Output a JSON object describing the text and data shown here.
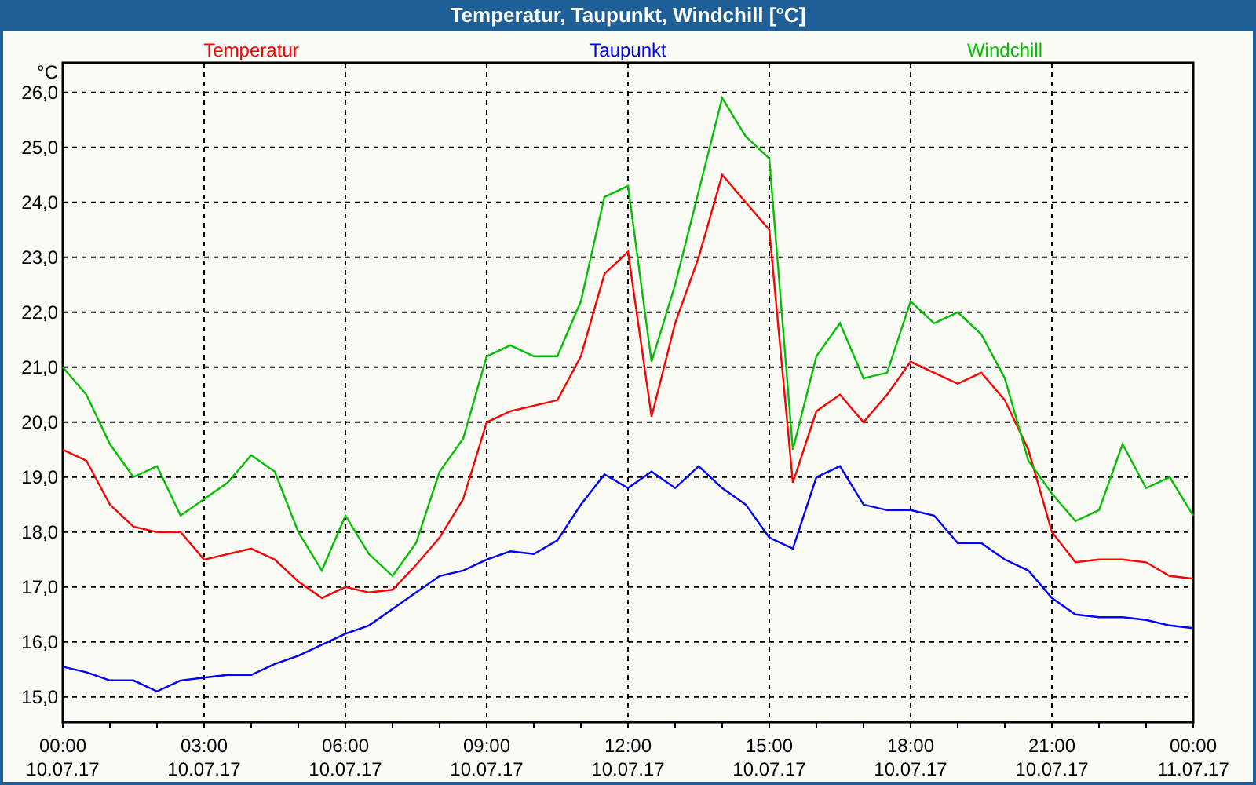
{
  "window": {
    "title": "Temperatur, Taupunkt, Windchill [°C]"
  },
  "chart": {
    "chart_data": {
      "type": "line",
      "ylabel": "°C",
      "categories": [
        "00:00 10.07.17",
        null,
        null,
        null,
        null,
        null,
        "03:00 10.07.17",
        null,
        null,
        null,
        null,
        null,
        "06:00 10.07.17",
        null,
        null,
        null,
        null,
        null,
        "09:00 10.07.17",
        null,
        null,
        null,
        null,
        null,
        "12:00 10.07.17",
        null,
        null,
        null,
        null,
        null,
        "15:00 10.07.17",
        null,
        null,
        null,
        null,
        null,
        "18:00 10.07.17",
        null,
        null,
        null,
        null,
        null,
        "21:00 10.07.17",
        null,
        null,
        null,
        null,
        null,
        "00:00 11.07.17"
      ],
      "series": [
        {
          "name": "Temperatur",
          "color": "#ff0000",
          "values": [
            19.5,
            19.3,
            18.5,
            18.1,
            18.0,
            18.0,
            17.5,
            17.6,
            17.7,
            17.5,
            17.1,
            16.8,
            17.0,
            16.9,
            16.95,
            17.4,
            17.9,
            18.6,
            20.0,
            20.2,
            20.3,
            20.4,
            21.2,
            22.7,
            23.1,
            20.1,
            21.8,
            23.0,
            24.5,
            24.0,
            23.5,
            18.9,
            20.2,
            20.5,
            20.0,
            20.5,
            21.1,
            20.9,
            20.7,
            20.9,
            20.4,
            19.5,
            18.0,
            17.45,
            17.5,
            17.5,
            17.45,
            17.2,
            17.15
          ]
        },
        {
          "name": "Taupunkt",
          "color": "#0000ff",
          "values": [
            15.55,
            15.45,
            15.3,
            15.3,
            15.1,
            15.3,
            15.35,
            15.4,
            15.4,
            15.6,
            15.75,
            15.95,
            16.15,
            16.3,
            16.6,
            16.9,
            17.2,
            17.3,
            17.5,
            17.65,
            17.6,
            17.85,
            18.5,
            19.05,
            18.8,
            19.1,
            18.8,
            19.2,
            18.8,
            18.5,
            17.9,
            17.7,
            19.0,
            19.2,
            18.5,
            18.4,
            18.4,
            18.3,
            17.8,
            17.8,
            17.5,
            17.3,
            16.8,
            16.5,
            16.45,
            16.45,
            16.4,
            16.3,
            16.25
          ]
        },
        {
          "name": "Windchill",
          "color": "#00c000",
          "values": [
            21.0,
            20.5,
            19.6,
            19.0,
            19.2,
            18.3,
            18.6,
            18.9,
            19.4,
            19.1,
            18.0,
            17.3,
            18.3,
            17.6,
            17.2,
            17.8,
            19.1,
            19.7,
            21.2,
            21.4,
            21.2,
            21.2,
            22.2,
            24.1,
            24.3,
            21.1,
            22.5,
            24.2,
            25.9,
            25.2,
            24.8,
            19.5,
            21.2,
            21.8,
            20.8,
            20.9,
            22.2,
            21.8,
            22.0,
            21.6,
            20.8,
            19.3,
            18.7,
            18.2,
            18.4,
            19.6,
            18.8,
            19.0,
            18.3
          ]
        }
      ],
      "grid": true,
      "ylim": [
        14.54,
        26.54
      ],
      "yticks": [
        {
          "value": 15,
          "label": "15,0"
        },
        {
          "value": 16,
          "label": "16,0"
        },
        {
          "value": 17,
          "label": "17,0"
        },
        {
          "value": 18,
          "label": "18,0"
        },
        {
          "value": 19,
          "label": "19,0"
        },
        {
          "value": 20,
          "label": "20,0"
        },
        {
          "value": 21,
          "label": "21,0"
        },
        {
          "value": 22,
          "label": "22,0"
        },
        {
          "value": 23,
          "label": "23,0"
        },
        {
          "value": 24,
          "label": "24,0"
        },
        {
          "value": 25,
          "label": "25,0"
        },
        {
          "value": 26,
          "label": "26,0"
        }
      ]
    }
  }
}
